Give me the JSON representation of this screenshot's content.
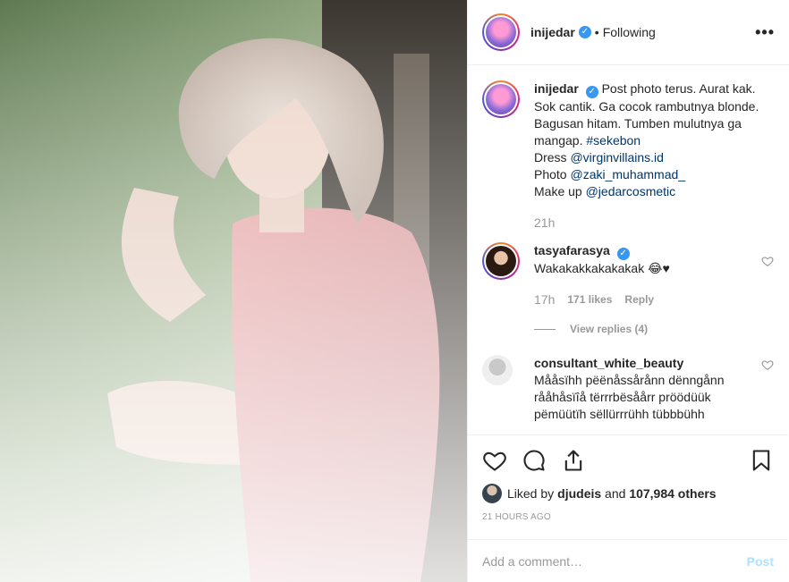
{
  "header": {
    "username": "inijedar",
    "separator": "•",
    "follow_status": "Following",
    "more_glyph": "•••"
  },
  "caption": {
    "username": "inijedar",
    "text_parts": [
      "Post photo terus. Aurat kak. Sok cantik. Ga cocok rambutnya blonde. Bagusan hitam. Tumben mulutnya ga mangap. ",
      "#sekebon",
      "Dress ",
      "@virginvillains.id",
      "Photo ",
      "@zaki_muhammad_",
      "Make up ",
      "@jedarcosmetic"
    ],
    "time": "21h"
  },
  "comments": [
    {
      "username": "tasyafarasya",
      "verified": true,
      "text": "Wakakakkakakakak 😂♥",
      "time": "17h",
      "likes": "171 likes",
      "reply": "Reply",
      "view_replies": "View replies (4)"
    },
    {
      "username": "consultant_white_beauty",
      "verified": false,
      "text": "Mååsïhh pëënåssårånn dënngånn rååhåsïîå tërrrbësåårr pröödüük pëmüütïh sëllürrrühh tübbbühh"
    }
  ],
  "actions": {
    "icons": [
      "heart-icon",
      "comment-icon",
      "share-icon",
      "bookmark-icon"
    ],
    "liked_by_prefix": "Liked by ",
    "liked_by_user": "djudeis",
    "liked_by_mid": " and ",
    "liked_by_count": "107,984 others",
    "timestamp": "21 HOURS AGO"
  },
  "add_comment": {
    "placeholder": "Add a comment…",
    "post_label": "Post"
  },
  "colors": {
    "verified_blue": "#3897f0",
    "link": "#003569",
    "muted": "#999999",
    "post_disabled": "#b2dffc",
    "border": "#efefef"
  }
}
